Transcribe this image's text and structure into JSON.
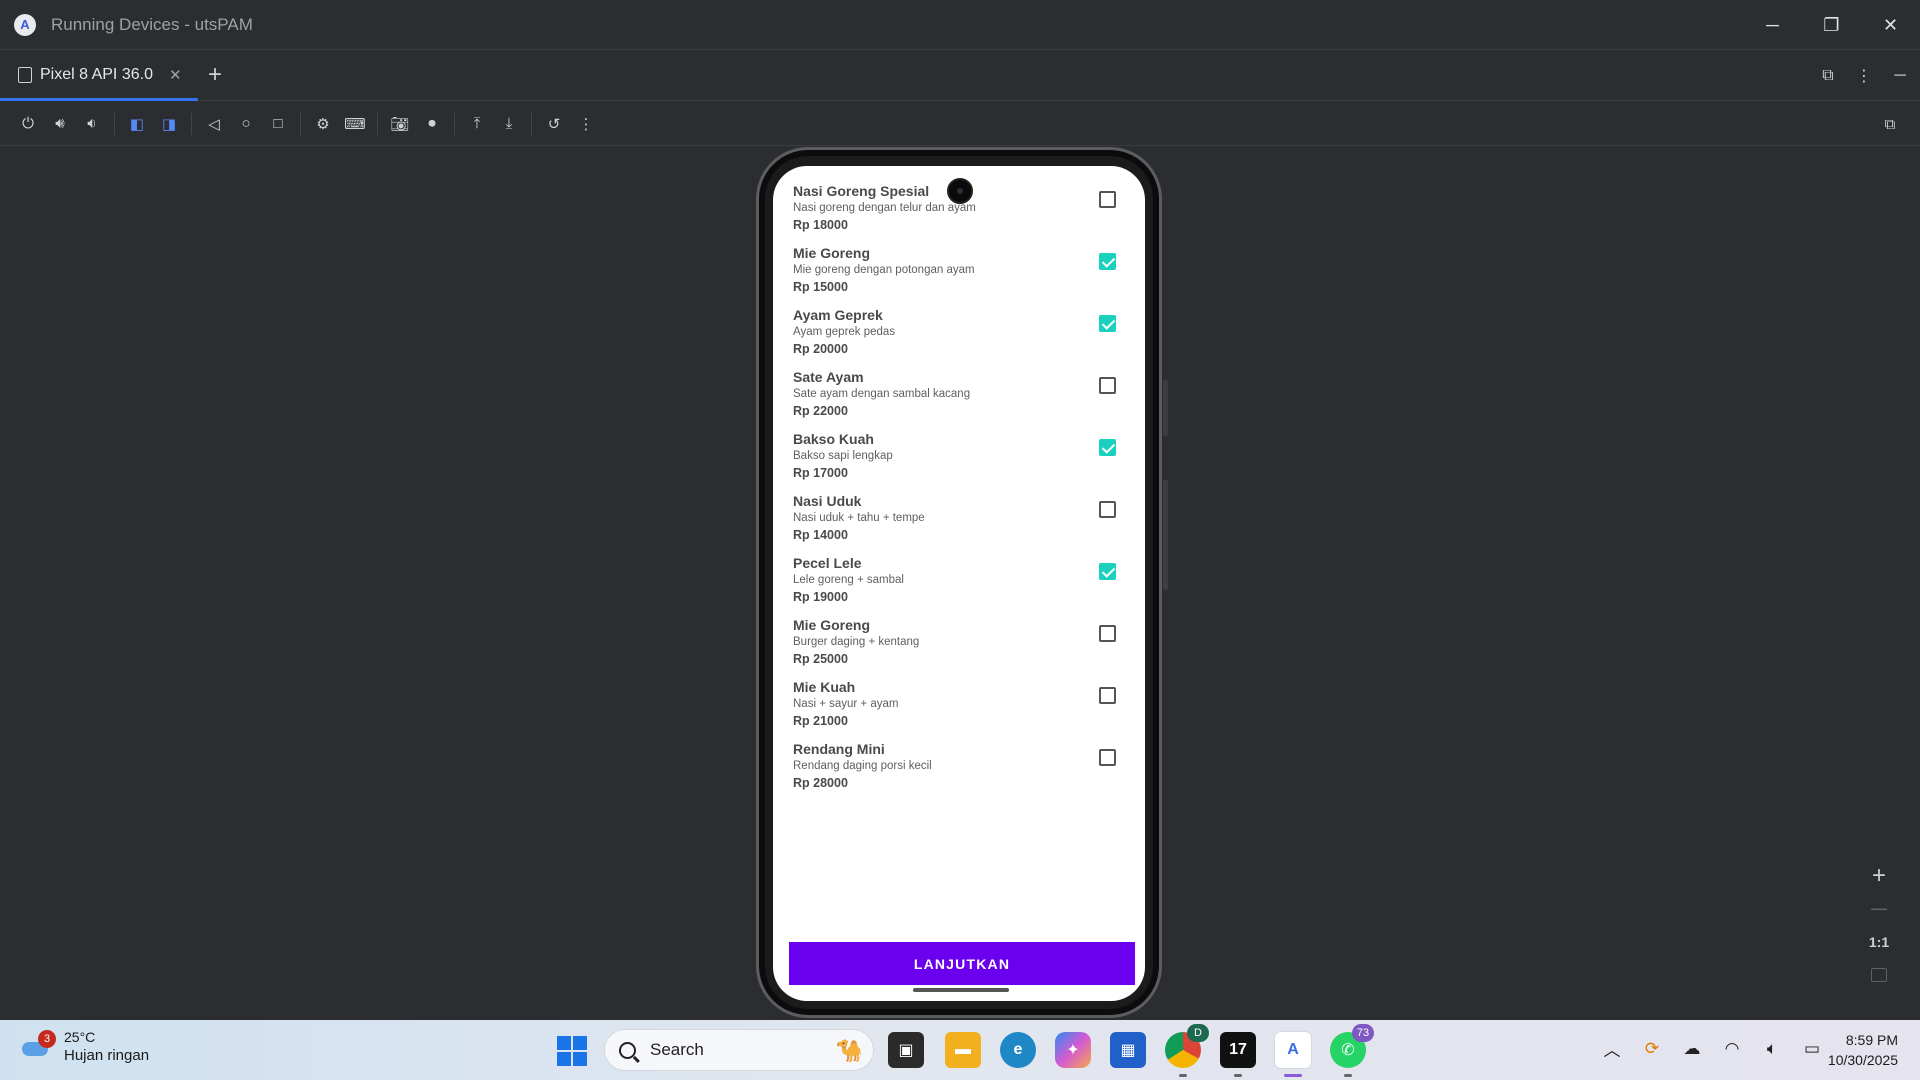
{
  "window": {
    "title": "Running Devices - utsPAM",
    "logo": "A"
  },
  "tabs": [
    {
      "label": "Pixel 8 API 36.0"
    }
  ],
  "menu": {
    "items": [
      {
        "name": "Nasi Goreng Spesial",
        "desc": "Nasi goreng dengan telur dan ayam",
        "price": "Rp 18000",
        "checked": false
      },
      {
        "name": "Mie Goreng",
        "desc": "Mie goreng dengan potongan ayam",
        "price": "Rp 15000",
        "checked": true
      },
      {
        "name": "Ayam Geprek",
        "desc": "Ayam geprek pedas",
        "price": "Rp 20000",
        "checked": true
      },
      {
        "name": "Sate Ayam",
        "desc": "Sate ayam dengan sambal kacang",
        "price": "Rp 22000",
        "checked": false
      },
      {
        "name": "Bakso Kuah",
        "desc": "Bakso sapi lengkap",
        "price": "Rp 17000",
        "checked": true
      },
      {
        "name": "Nasi Uduk",
        "desc": "Nasi uduk + tahu + tempe",
        "price": "Rp 14000",
        "checked": false
      },
      {
        "name": "Pecel Lele",
        "desc": "Lele goreng + sambal",
        "price": "Rp 19000",
        "checked": true
      },
      {
        "name": "Mie Goreng",
        "desc": "Burger daging + kentang",
        "price": "Rp 25000",
        "checked": false
      },
      {
        "name": "Mie Kuah",
        "desc": "Nasi + sayur + ayam",
        "price": "Rp 21000",
        "checked": false
      },
      {
        "name": "Rendang Mini",
        "desc": "Rendang daging porsi kecil",
        "price": "Rp 28000",
        "checked": false
      }
    ],
    "continue_label": "LANJUTKAN",
    "accent_color": "#6a00ee",
    "check_color": "#1ad1bf"
  },
  "zoom": {
    "one_to_one": "1:1"
  },
  "taskbar": {
    "weather_badge": "3",
    "weather_temp": "25°C",
    "weather_desc": "Hujan ringan",
    "search_label": "Search",
    "whatsapp_badge": "73",
    "chrome_badge": "D",
    "time": "8:59 PM",
    "date": "10/30/2025"
  }
}
